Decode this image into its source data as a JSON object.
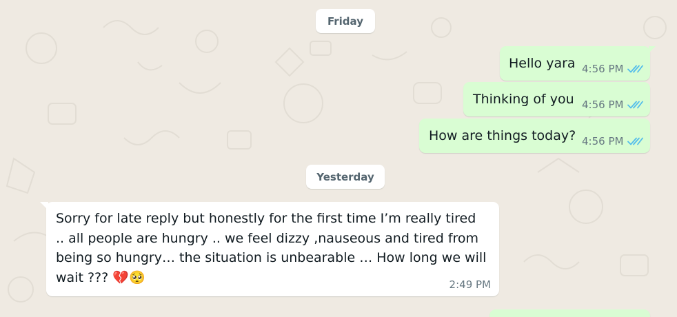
{
  "chat": {
    "day_labels": {
      "friday": "Friday",
      "yesterday": "Yesterday"
    },
    "messages": [
      {
        "direction": "outgoing",
        "text": "Hello yara",
        "time": "4:56 PM",
        "status": "read"
      },
      {
        "direction": "outgoing",
        "text": "Thinking of you",
        "time": "4:56 PM",
        "status": "read"
      },
      {
        "direction": "outgoing",
        "text": "How are things today?",
        "time": "4:56 PM",
        "status": "read"
      },
      {
        "direction": "incoming",
        "text": "Sorry for late reply but honestly for the first time I’m really tired .. all people are hungry .. we feel dizzy ,nauseous and tired from being so hungry… the situation is unbearable … How long we will wait ???",
        "emojis": [
          "💔",
          "🥺"
        ],
        "time": "2:49 PM"
      }
    ]
  },
  "colors": {
    "background": "#efeae2",
    "outgoing_bubble": "#d9fdd3",
    "incoming_bubble": "#ffffff",
    "read_ticks": "#53bdeb",
    "meta_text": "#667781"
  },
  "icons": {
    "read_receipt": "double-check-icon"
  }
}
